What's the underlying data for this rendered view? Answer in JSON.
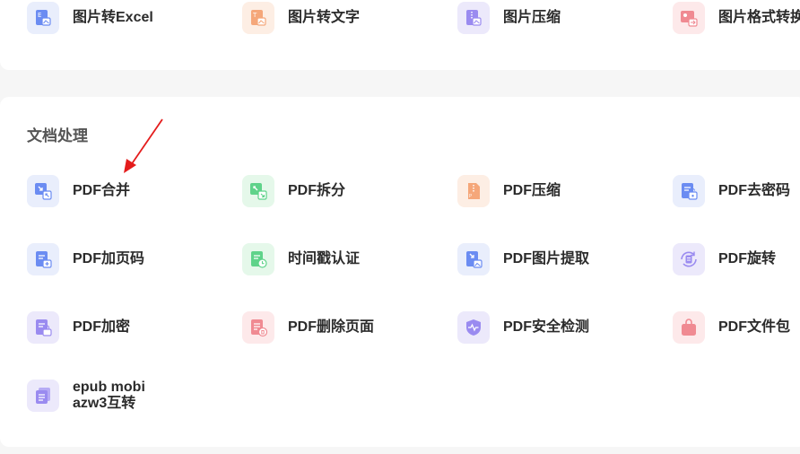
{
  "top_tools": [
    {
      "label": "图片转Excel",
      "icon": "image-to-excel-icon",
      "bg": "#e9eefc",
      "fg": "#6b8cf2"
    },
    {
      "label": "图片转文字",
      "icon": "image-to-text-icon",
      "bg": "#fdeee4",
      "fg": "#f5a77a"
    },
    {
      "label": "图片压缩",
      "icon": "image-compress-icon",
      "bg": "#ece9fb",
      "fg": "#9a8bf0"
    },
    {
      "label": "图片格式转换",
      "icon": "image-format-icon",
      "bg": "#fde9ea",
      "fg": "#f08a92"
    }
  ],
  "section": {
    "title": "文档处理"
  },
  "doc_tools": [
    {
      "label": "PDF合并",
      "icon": "pdf-merge-icon",
      "bg": "#e9eefc",
      "fg": "#6b8cf2"
    },
    {
      "label": "PDF拆分",
      "icon": "pdf-split-icon",
      "bg": "#e5f8ea",
      "fg": "#5fd38a"
    },
    {
      "label": "PDF压缩",
      "icon": "pdf-compress-icon",
      "bg": "#fdeee4",
      "fg": "#f5a77a"
    },
    {
      "label": "PDF去密码",
      "icon": "pdf-remove-password-icon",
      "bg": "#e9eefc",
      "fg": "#6b8cf2"
    },
    {
      "label": "PDF加页码",
      "icon": "pdf-add-page-number-icon",
      "bg": "#e9eefc",
      "fg": "#6b8cf2"
    },
    {
      "label": "时间戳认证",
      "icon": "timestamp-icon",
      "bg": "#e5f8ea",
      "fg": "#5fd38a"
    },
    {
      "label": "PDF图片提取",
      "icon": "pdf-image-extract-icon",
      "bg": "#e9eefc",
      "fg": "#6b8cf2"
    },
    {
      "label": "PDF旋转",
      "icon": "pdf-rotate-icon",
      "bg": "#ece9fb",
      "fg": "#9a8bf0"
    },
    {
      "label": "PDF加密",
      "icon": "pdf-encrypt-icon",
      "bg": "#ece9fb",
      "fg": "#9a8bf0"
    },
    {
      "label": "PDF删除页面",
      "icon": "pdf-delete-page-icon",
      "bg": "#fde9ea",
      "fg": "#f08a92"
    },
    {
      "label": "PDF安全检测",
      "icon": "pdf-security-check-icon",
      "bg": "#ece9fb",
      "fg": "#9a8bf0"
    },
    {
      "label": "PDF文件包",
      "icon": "pdf-package-icon",
      "bg": "#fde9ea",
      "fg": "#f08a92"
    },
    {
      "label": "epub mobi azw3互转",
      "icon": "ebook-convert-icon",
      "bg": "#ece9fb",
      "fg": "#9a8bf0"
    }
  ],
  "annotation_color": "#e41c1c"
}
